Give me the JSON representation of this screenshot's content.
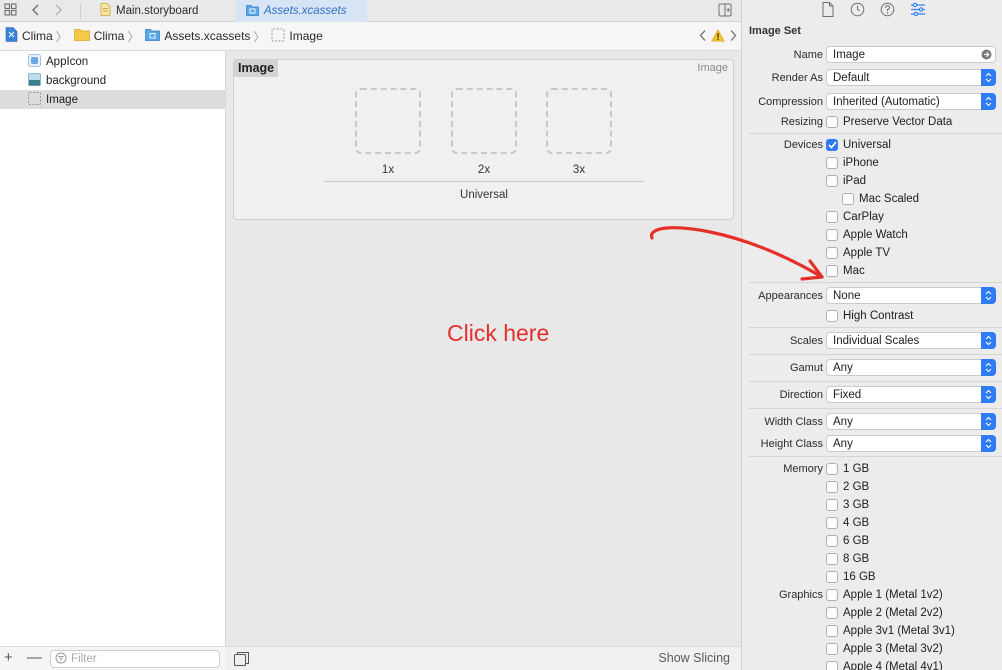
{
  "tabs": [
    {
      "label": "Main.storyboard"
    },
    {
      "label": "Assets.xcassets"
    }
  ],
  "breadcrumb": [
    {
      "label": "Clima"
    },
    {
      "label": "Clima"
    },
    {
      "label": "Assets.xcassets"
    },
    {
      "label": "Image"
    }
  ],
  "navigator": {
    "items": [
      {
        "label": "AppIcon"
      },
      {
        "label": "background"
      },
      {
        "label": "Image",
        "selected": true
      }
    ],
    "filter_placeholder": "Filter"
  },
  "editor": {
    "set_title": "Image",
    "set_type": "Image",
    "scales": [
      "1x",
      "2x",
      "3x"
    ],
    "group_label": "Universal",
    "annotation": "Click here",
    "footer_button": "Show Slicing"
  },
  "inspector": {
    "section_title": "Image Set",
    "name_label": "Name",
    "name_value": "Image",
    "render_as_label": "Render As",
    "render_as_value": "Default",
    "compression_label": "Compression",
    "compression_value": "Inherited (Automatic)",
    "resizing_label": "Resizing",
    "preserve_vector": "Preserve Vector Data",
    "devices_label": "Devices",
    "devices": [
      {
        "label": "Universal",
        "checked": true
      },
      {
        "label": "iPhone",
        "checked": false
      },
      {
        "label": "iPad",
        "checked": false
      },
      {
        "label": "Mac Scaled",
        "checked": false
      },
      {
        "label": "CarPlay",
        "checked": false
      },
      {
        "label": "Apple Watch",
        "checked": false
      },
      {
        "label": "Apple TV",
        "checked": false
      },
      {
        "label": "Mac",
        "checked": false
      }
    ],
    "appearances_label": "Appearances",
    "appearances_value": "None",
    "high_contrast": "High Contrast",
    "scales_label": "Scales",
    "scales_value": "Individual Scales",
    "gamut_label": "Gamut",
    "gamut_value": "Any",
    "direction_label": "Direction",
    "direction_value": "Fixed",
    "width_class_label": "Width Class",
    "width_class_value": "Any",
    "height_class_label": "Height Class",
    "height_class_value": "Any",
    "memory_label": "Memory",
    "memory": [
      "1 GB",
      "2 GB",
      "3 GB",
      "4 GB",
      "6 GB",
      "8 GB",
      "16 GB"
    ],
    "graphics_label": "Graphics",
    "graphics": [
      "Apple 1 (Metal 1v2)",
      "Apple 2 (Metal 2v2)",
      "Apple 3v1 (Metal 3v1)",
      "Apple 3 (Metal 3v2)",
      "Apple 4 (Metal 4v1)"
    ]
  },
  "colors": {
    "accent": "#2f7cf6",
    "annotation": "#e5302a",
    "selection": "#dcdcdc"
  }
}
